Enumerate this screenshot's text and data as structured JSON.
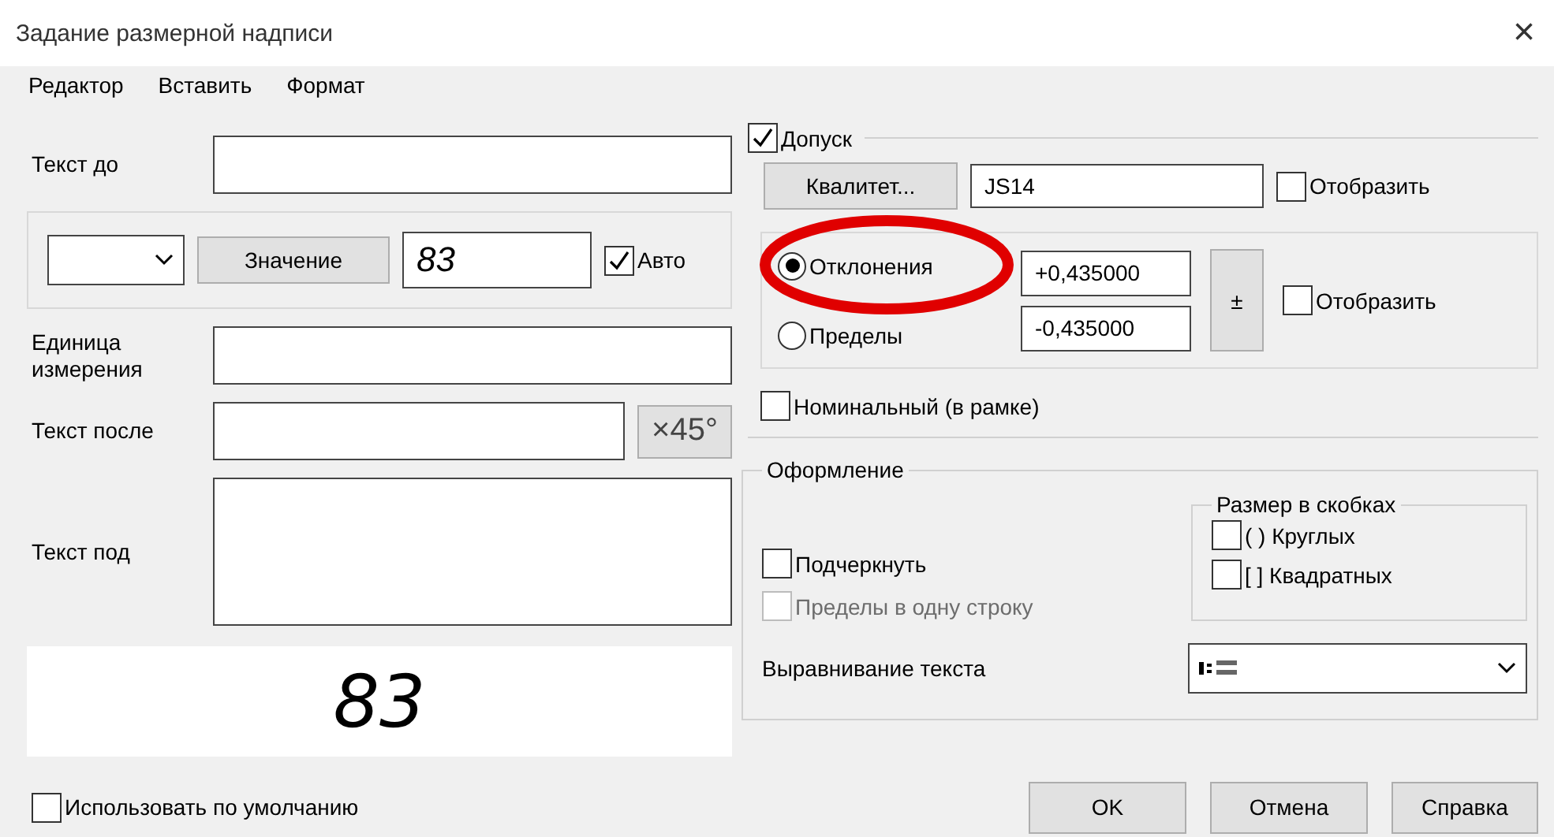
{
  "window": {
    "title": "Задание размерной надписи",
    "close": "×"
  },
  "menu": [
    "Редактор",
    "Вставить",
    "Формат"
  ],
  "left": {
    "text_before": {
      "label": "Текст до"
    },
    "value_group": {
      "button": "Значение",
      "value": "83",
      "auto": {
        "label": "Авто",
        "checked": true
      }
    },
    "unit": {
      "label": "Единица измерения"
    },
    "text_after": {
      "label": "Текст после",
      "button": "×45°"
    },
    "text_under": {
      "label": "Текст под"
    },
    "preview": "83",
    "use_default": {
      "label": "Использовать по умолчанию",
      "checked": false
    }
  },
  "tolerance": {
    "label": "Допуск",
    "checked": true,
    "quality": {
      "button": "Квалитет...",
      "value": "JS14",
      "show": {
        "label": "Отобразить",
        "checked": false
      }
    },
    "modes": [
      {
        "label": "Отклонения",
        "selected": true
      },
      {
        "label": "Пределы",
        "selected": false
      }
    ],
    "upper": "+0,435000",
    "lower": "-0,435000",
    "plusminus": "±",
    "show": {
      "label": "Отобразить",
      "checked": false
    },
    "nominal": {
      "label": "Номинальный (в рамке)",
      "checked": false
    }
  },
  "design": {
    "title": "Оформление",
    "options": [
      {
        "label": "Подчеркнуть",
        "checked": false,
        "disabled": false
      },
      {
        "label": "Пределы в одну строку",
        "checked": false,
        "disabled": true
      }
    ],
    "brackets": {
      "title": "Размер в скобках",
      "options": [
        {
          "label": "( ) Круглых",
          "checked": false
        },
        {
          "label": "[ ] Квадратных",
          "checked": false
        }
      ]
    },
    "alignment": {
      "label": "Выравнивание текста"
    }
  },
  "buttons": [
    "OK",
    "Отмена",
    "Справка"
  ],
  "annotation": {
    "kind": "ellipse"
  }
}
